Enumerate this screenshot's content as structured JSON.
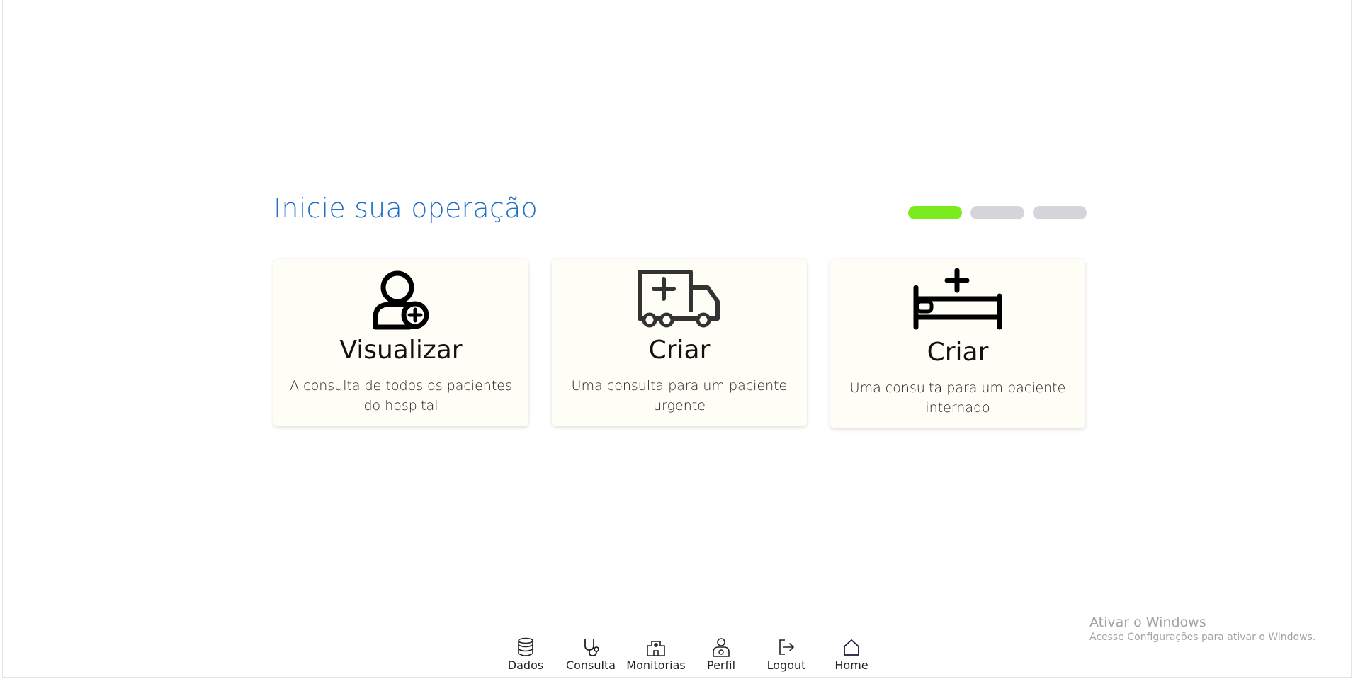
{
  "main": {
    "title": "Inicie sua operação",
    "progress": {
      "total_steps": 3,
      "current_step": 1
    },
    "cards": [
      {
        "icon": "user-plus-icon",
        "label": "Visualizar",
        "description": "A consulta de todos os pacientes do hospital"
      },
      {
        "icon": "ambulance-icon",
        "label": "Criar",
        "description": "Uma consulta para um paciente urgente"
      },
      {
        "icon": "hospital-bed-icon",
        "label": "Criar",
        "description": "Uma consulta para um paciente internado"
      }
    ]
  },
  "nav": {
    "items": [
      {
        "icon": "database-icon",
        "label": "Dados"
      },
      {
        "icon": "stethoscope-icon",
        "label": "Consulta"
      },
      {
        "icon": "hospital-icon",
        "label": "Monitorias"
      },
      {
        "icon": "doctor-icon",
        "label": "Perfil"
      },
      {
        "icon": "logout-icon",
        "label": "Logout"
      },
      {
        "icon": "home-icon",
        "label": "Home"
      }
    ]
  },
  "watermark": {
    "title": "Ativar o Windows",
    "subtitle": "Acesse Configurações para ativar o Windows."
  },
  "colors": {
    "title": "#1f6fc6",
    "step_active": "#7aeb1e",
    "step_inactive": "#d3d5da",
    "card_bg": "#fffef6"
  }
}
